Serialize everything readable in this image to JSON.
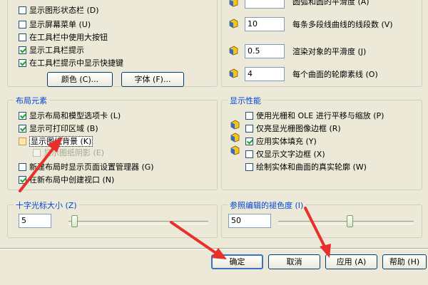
{
  "window_elements": {
    "checkboxes": [
      {
        "label": "显示图形状态栏 (D)",
        "checked": false
      },
      {
        "label": "显示屏幕菜单 (U)",
        "checked": false
      },
      {
        "label": "在工具栏中使用大按钮",
        "checked": false
      },
      {
        "label": "显示工具栏提示",
        "checked": true
      },
      {
        "label": "在工具栏提示中显示快捷键",
        "checked": true
      }
    ],
    "colors_button": "颜色 (C)...",
    "fonts_button": "字体 (F)..."
  },
  "display_resolution": {
    "rows": [
      {
        "value": "",
        "label": "圆弧和圆的平滑度 (A)"
      },
      {
        "value": "10",
        "label": "每条多段线曲线的线段数 (V)"
      },
      {
        "value": "0.5",
        "label": "渲染对象的平滑度 (J)"
      },
      {
        "value": "4",
        "label": "每个曲面的轮廓素线 (O)"
      }
    ]
  },
  "layout_elements": {
    "title": "布局元素",
    "items": [
      {
        "label": "显示布局和模型选项卡 (L)",
        "checked": true
      },
      {
        "label": "显示可打印区域 (B)",
        "checked": true
      },
      {
        "label": "显示图纸背景 (K)",
        "checked": false
      },
      {
        "label": "显示图纸阴影 (E)",
        "checked": false
      },
      {
        "label": "新建布局时显示页面设置管理器 (G)",
        "checked": false
      },
      {
        "label": "在新布局中创建视口 (N)",
        "checked": true
      }
    ]
  },
  "display_performance": {
    "title": "显示性能",
    "items": [
      {
        "label": "使用光栅和 OLE 进行平移与缩放 (P)",
        "checked": false
      },
      {
        "label": "仅亮显光栅图像边框 (R)",
        "checked": false
      },
      {
        "label": "应用实体填充 (Y)",
        "checked": true
      },
      {
        "label": "仅显示文字边框 (X)",
        "checked": false
      },
      {
        "label": "绘制实体和曲面的真实轮廓 (W)",
        "checked": false
      }
    ]
  },
  "crosshair": {
    "title": "十字光标大小 (Z)",
    "value": "5",
    "level_percent": 5
  },
  "xref_fade": {
    "title": "参照编辑的褪色度 (I)",
    "value": "50",
    "level_percent": 50
  },
  "buttons": {
    "ok": "确定",
    "cancel": "取消",
    "apply": "应用 (A)",
    "help": "帮助 (H)"
  },
  "colors": {
    "annotation_arrow": "#e8302a",
    "accent_blue": "#0046d5"
  }
}
